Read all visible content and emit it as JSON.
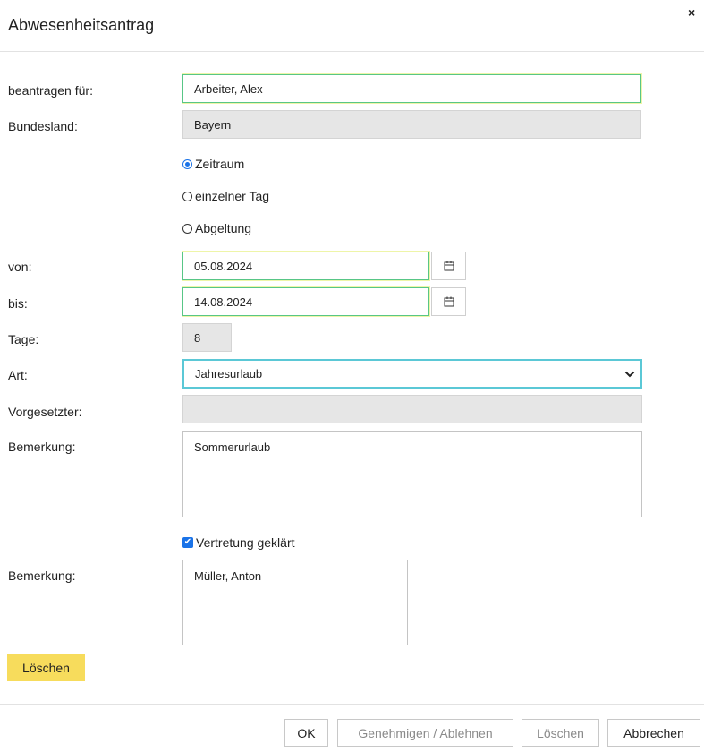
{
  "dialog": {
    "title": "Abwesenheitsantrag",
    "close_label": "×"
  },
  "form": {
    "beantragen_label": "beantragen für:",
    "beantragen_value": "Arbeiter, Alex",
    "bundesland_label": "Bundesland:",
    "bundesland_value": "Bayern",
    "mode_options": [
      {
        "label": "Zeitraum",
        "selected": true
      },
      {
        "label": "einzelner Tag",
        "selected": false
      },
      {
        "label": "Abgeltung",
        "selected": false
      }
    ],
    "von_label": "von:",
    "von_value": "05.08.2024",
    "bis_label": "bis:",
    "bis_value": "14.08.2024",
    "tage_label": "Tage:",
    "tage_value": "8",
    "art_label": "Art:",
    "art_value": "Jahresurlaub",
    "vorgesetzter_label": "Vorgesetzter:",
    "vorgesetzter_value": "",
    "bemerkung_label": "Bemerkung:",
    "bemerkung_value": "Sommerurlaub",
    "vertretung_label": "Vertretung geklärt",
    "vertretung_checked": true,
    "bemerkung2_label": "Bemerkung:",
    "bemerkung2_value": "Müller, Anton"
  },
  "actions": {
    "loeschen_primary": "Löschen",
    "ok": "OK",
    "genehmigen": "Genehmigen / Ablehnen",
    "loeschen": "Löschen",
    "abbrechen": "Abbrechen"
  },
  "icons": {
    "calendar": "calendar-icon",
    "chevron": "chevron-down-icon",
    "check": "✔"
  },
  "colors": {
    "accent": "#1a73e8",
    "focus_border": "#58c686",
    "select_border": "#5bc8d6",
    "delete_button": "#f7dc5c"
  }
}
